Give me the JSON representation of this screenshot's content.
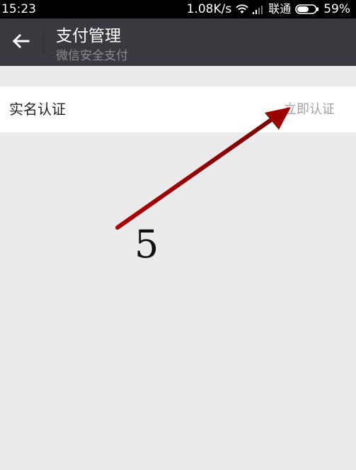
{
  "status_bar": {
    "time": "15:23",
    "speed": "1.08K/s",
    "carrier": "联通",
    "battery": "59%",
    "icons": [
      "wifi-icon",
      "signal-icon",
      "battery-icon"
    ]
  },
  "action_bar": {
    "back_icon": "arrow-left-icon",
    "title": "支付管理",
    "subtitle": "微信安全支付"
  },
  "list": {
    "items": [
      {
        "label": "实名认证",
        "action": "立即认证"
      }
    ]
  },
  "annotation": {
    "number": "5",
    "arrow_color": "#c00000"
  },
  "colors": {
    "action_bar_bg": "#393a3f",
    "page_bg": "#ebebeb",
    "row_bg": "#ffffff"
  }
}
